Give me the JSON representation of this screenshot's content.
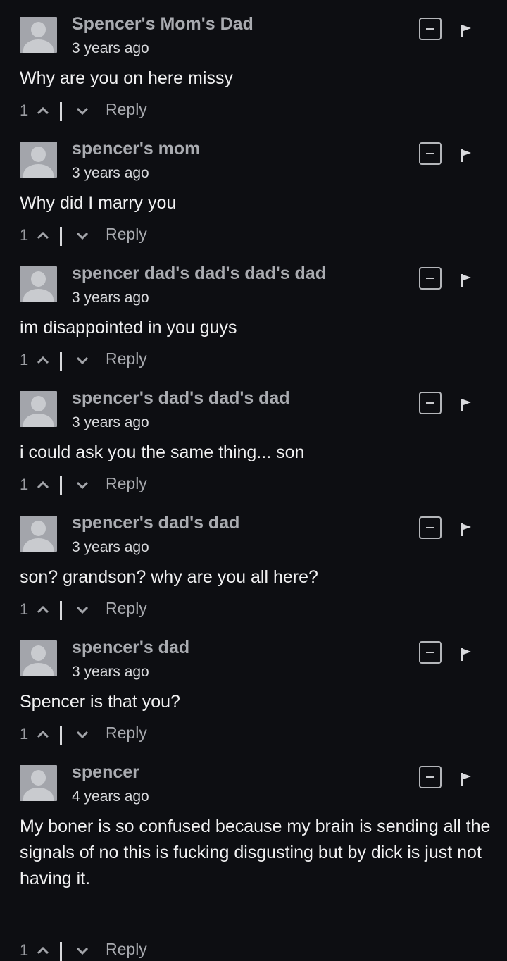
{
  "icons": {
    "avatar": "default-user-avatar",
    "collapse": "minus-square-icon",
    "flag": "flag-icon",
    "upvote": "chevron-up-icon",
    "downvote": "chevron-down-icon"
  },
  "colors": {
    "background": "#0d0e12",
    "author": "#a9abb0",
    "text": "#f1f1f2",
    "muted": "#9b9da2"
  },
  "comments": [
    {
      "author": "Spencer's Mom's Dad",
      "time": "3 years ago",
      "text": "Why are you on here missy",
      "votes": "1",
      "reply": "Reply"
    },
    {
      "author": "spencer's mom",
      "time": "3 years ago",
      "text": "Why did I marry you",
      "votes": "1",
      "reply": "Reply"
    },
    {
      "author": "spencer dad's dad's dad's dad",
      "time": "3 years ago",
      "text": "im disappointed in you guys",
      "votes": "1",
      "reply": "Reply"
    },
    {
      "author": "spencer's dad's dad's dad",
      "time": "3 years ago",
      "text": "i could ask you the same thing... son",
      "votes": "1",
      "reply": "Reply"
    },
    {
      "author": "spencer's dad's dad",
      "time": "3 years ago",
      "text": "son? grandson? why are you all here?",
      "votes": "1",
      "reply": "Reply"
    },
    {
      "author": "spencer's dad",
      "time": "3 years ago",
      "text": "Spencer is that you?",
      "votes": "1",
      "reply": "Reply"
    },
    {
      "author": "spencer",
      "time": "4 years ago",
      "text": "My boner is so confused because my brain is sending all the signals of no this is fucking disgusting but by dick is just not having it.",
      "votes": "1",
      "reply": "Reply"
    }
  ]
}
